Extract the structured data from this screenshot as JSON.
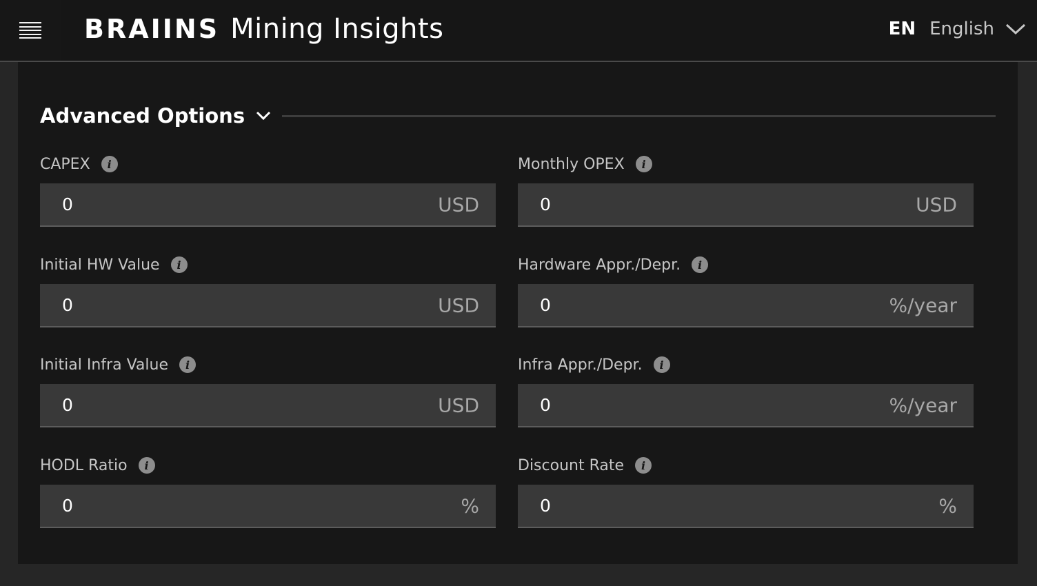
{
  "header": {
    "brand_logo": "BRAIINS",
    "app_title": "Mining Insights",
    "language": {
      "code": "EN",
      "name": "English"
    }
  },
  "section": {
    "title": "Advanced Options",
    "expanded": true
  },
  "fields": [
    {
      "label": "CAPEX",
      "value": "0",
      "unit": "USD"
    },
    {
      "label": "Monthly OPEX",
      "value": "0",
      "unit": "USD"
    },
    {
      "label": "Initial HW Value",
      "value": "0",
      "unit": "USD"
    },
    {
      "label": "Hardware Appr./Depr.",
      "value": "0",
      "unit": "%/year"
    },
    {
      "label": "Initial Infra Value",
      "value": "0",
      "unit": "USD"
    },
    {
      "label": "Infra Appr./Depr.",
      "value": "0",
      "unit": "%/year"
    },
    {
      "label": "HODL Ratio",
      "value": "0",
      "unit": "%"
    },
    {
      "label": "Discount Rate",
      "value": "0",
      "unit": "%"
    }
  ],
  "icons": {
    "info": "i"
  }
}
